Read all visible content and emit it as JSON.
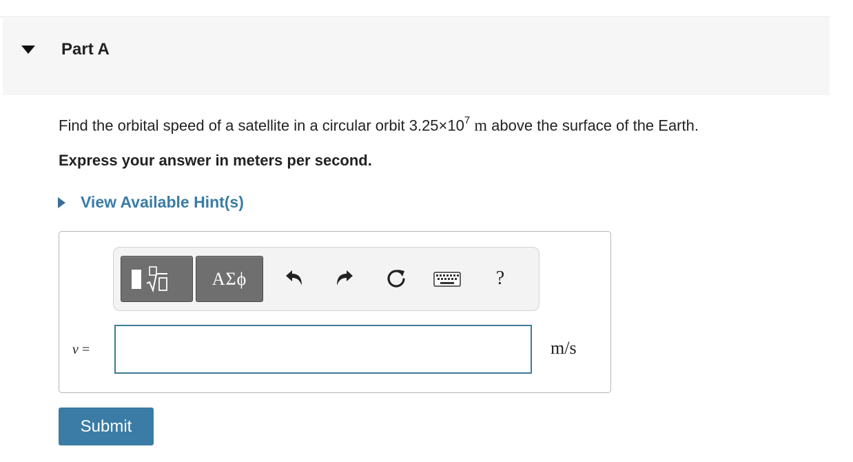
{
  "part": {
    "title": "Part A"
  },
  "question": {
    "text_before": "Find the orbital speed of a satellite in a circular orbit ",
    "mantissa": "3.25×10",
    "exponent": "7",
    "unit": "m",
    "text_after": " above the surface of the Earth.",
    "instruction": "Express your answer in meters per second."
  },
  "hint": {
    "label": "View Available Hint(s)"
  },
  "toolbar": {
    "symbols_label": "ΑΣϕ",
    "help_label": "?",
    "icons": [
      "templates-icon",
      "greek-symbols-icon",
      "undo-icon",
      "redo-icon",
      "reset-icon",
      "keyboard-icon",
      "help-icon"
    ]
  },
  "answer": {
    "variable": "v",
    "equals": " =",
    "value": "",
    "unit": "m/s"
  },
  "submit": {
    "label": "Submit"
  },
  "colors": {
    "accent": "#3a7ca5",
    "header_bg": "#f6f6f6",
    "toolbar_button": "#6f6f6f"
  }
}
